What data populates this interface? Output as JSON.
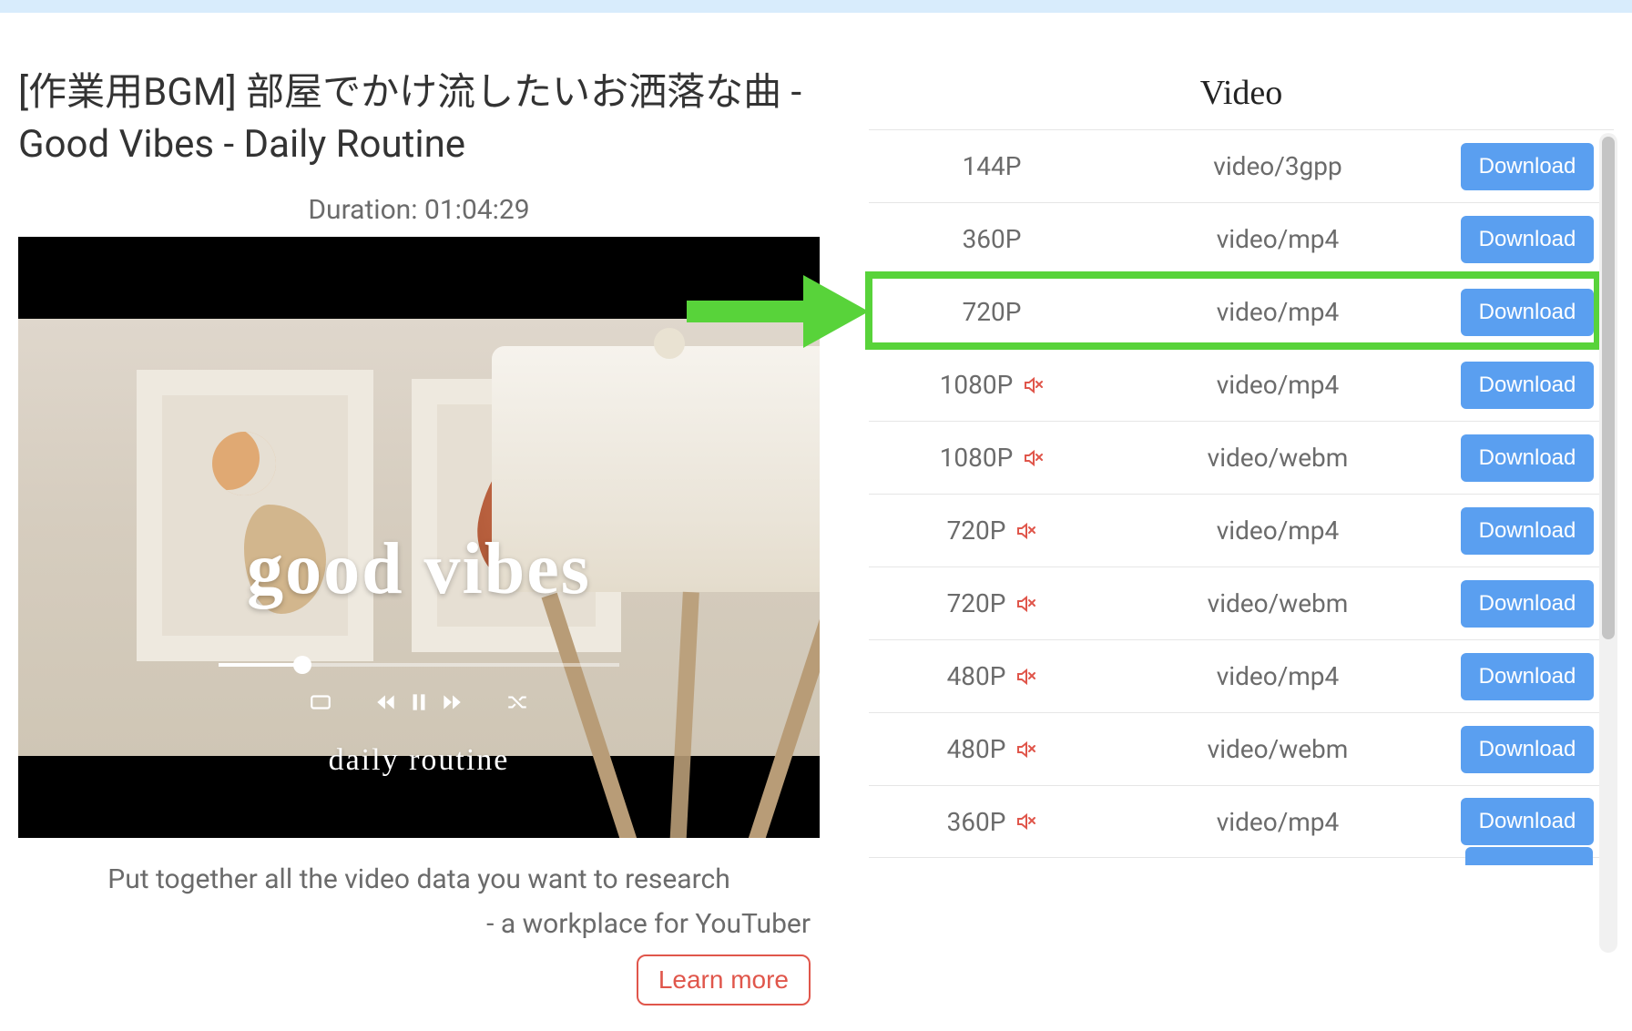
{
  "video": {
    "title": "[作業用BGM] 部屋でかけ流したいお洒落な曲 - Good Vibes - Daily Routine",
    "duration_label": "Duration: 01:04:29",
    "thumb_overlay_title": "good vibes",
    "thumb_overlay_sub": "daily routine"
  },
  "promo": {
    "line1": "Put together all the video data you want to research",
    "line2": "- a workplace for YouTuber",
    "learn_more": "Learn more"
  },
  "panel": {
    "title": "Video",
    "download_label": "Download",
    "rows": [
      {
        "res": "144P",
        "muted": false,
        "type": "video/3gpp"
      },
      {
        "res": "360P",
        "muted": false,
        "type": "video/mp4"
      },
      {
        "res": "720P",
        "muted": false,
        "type": "video/mp4"
      },
      {
        "res": "1080P",
        "muted": true,
        "type": "video/mp4"
      },
      {
        "res": "1080P",
        "muted": true,
        "type": "video/webm"
      },
      {
        "res": "720P",
        "muted": true,
        "type": "video/mp4"
      },
      {
        "res": "720P",
        "muted": true,
        "type": "video/webm"
      },
      {
        "res": "480P",
        "muted": true,
        "type": "video/mp4"
      },
      {
        "res": "480P",
        "muted": true,
        "type": "video/webm"
      },
      {
        "res": "360P",
        "muted": true,
        "type": "video/mp4"
      }
    ],
    "highlight_row_index": 2
  },
  "colors": {
    "button_blue": "#5a9ff0",
    "highlight_green": "#58d33a",
    "muted_red": "#e0564b"
  }
}
